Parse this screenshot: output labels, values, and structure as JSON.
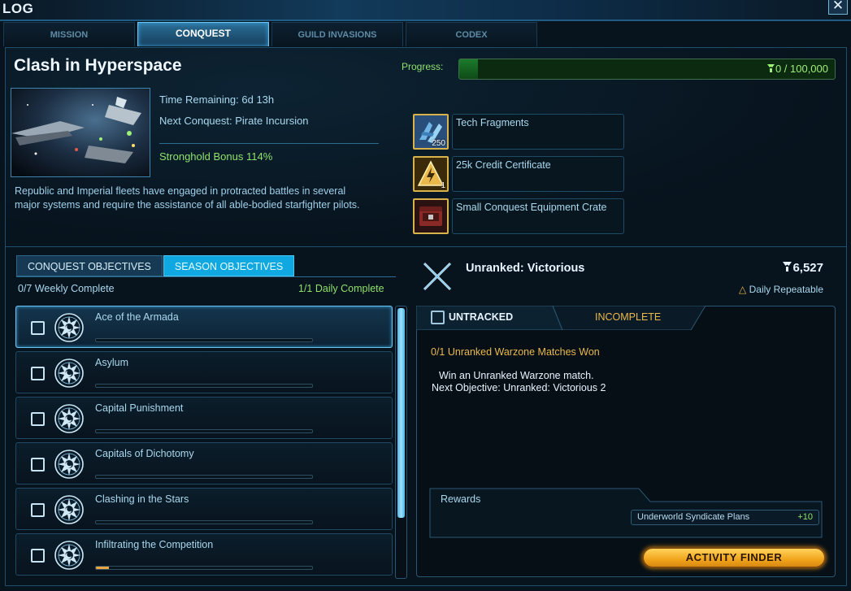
{
  "window": {
    "title": "LOG",
    "close_label": "✕"
  },
  "tabs": [
    {
      "label": "MISSION",
      "active": false
    },
    {
      "label": "CONQUEST",
      "active": true
    },
    {
      "label": "GUILD INVASIONS",
      "active": false
    },
    {
      "label": "CODEX",
      "active": false
    }
  ],
  "conquest": {
    "title": "Clash in Hyperspace",
    "time_remaining": "Time Remaining:  6d 13h",
    "next_conquest": "Next Conquest: Pirate Incursion",
    "stronghold_bonus": "Stronghold Bonus 114%",
    "description": "Republic and Imperial fleets have engaged in protracted battles in several major systems and require the assistance of all able-bodied starfighter pilots.",
    "progress_label": "Progress:",
    "progress_text": "0 / 100,000",
    "progress_fraction": 0.05,
    "rewards": [
      {
        "name": "Tech Fragments",
        "qty": "250",
        "icon": "tech-fragments-icon"
      },
      {
        "name": "25k Credit Certificate",
        "qty": "1",
        "icon": "credit-certificate-icon"
      },
      {
        "name": "Small Conquest Equipment Crate",
        "qty": "",
        "icon": "equipment-crate-icon"
      }
    ]
  },
  "objectives": {
    "tab_conquest": "CONQUEST OBJECTIVES",
    "tab_season": "SEASON OBJECTIVES",
    "weekly": "0/7 Weekly Complete",
    "daily": "1/1 Daily Complete",
    "items": [
      {
        "name": "Ace of the Armada",
        "progress": 0,
        "selected": true
      },
      {
        "name": "Asylum",
        "progress": 0,
        "selected": false
      },
      {
        "name": "Capital Punishment",
        "progress": 0,
        "selected": false
      },
      {
        "name": "Capitals of Dichotomy",
        "progress": 0,
        "selected": false
      },
      {
        "name": "Clashing in the Stars",
        "progress": 0,
        "selected": false
      },
      {
        "name": "Infiltrating the Competition",
        "progress": 0.06,
        "selected": false
      }
    ]
  },
  "detail": {
    "title": "Unranked: Victorious",
    "points": "6,527",
    "repeat_label": "Daily Repeatable",
    "tracked_label": "UNTRACKED",
    "status": "INCOMPLETE",
    "task": "0/1 Unranked Warzone Matches Won",
    "task_description": "Win an Unranked Warzone match.",
    "next_objective": "Next Objective: Unranked: Victorious 2",
    "rewards_label": "Rewards",
    "reward_item": {
      "name": "Underworld Syndicate Plans",
      "value": "+10"
    },
    "finder_button": "ACTIVITY FINDER"
  },
  "colors": {
    "accent": "#0fa8e0",
    "green": "#8fe26b",
    "gold": "#e9b94b",
    "text": "#a9d8ef"
  }
}
